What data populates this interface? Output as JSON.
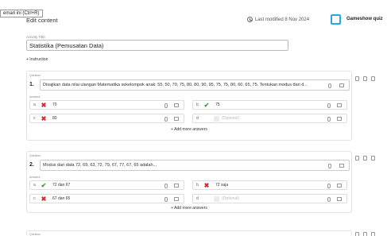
{
  "tooltip": "emari ini (Ctrl+R)",
  "header": {
    "title": "Edit content",
    "last_modified": "Last modified 8 Nov 2024",
    "mode_label": "Gameshow quiz"
  },
  "activity": {
    "label": "Activity Title",
    "title": "Statistika (Pemusatan Data)"
  },
  "instruction_label": "+ Instruction",
  "questions": [
    {
      "label": "Question",
      "number": "1.",
      "text": "Disajikan data nilai ulangan Matematika sekelompok anak: 55, 50, 70, 75, 80, 80, 90, 95, 75, 75, 80, 60, 65, 75. Tentukan modus dari d...",
      "answers_label": "Answers",
      "answers": [
        {
          "letter": "a",
          "mark": "✖",
          "text": "70"
        },
        {
          "letter": "b",
          "mark": "✔",
          "text": "75"
        },
        {
          "letter": "c",
          "mark": "✖",
          "text": "80"
        },
        {
          "letter": "d",
          "mark": "",
          "text": "(Optional)"
        }
      ],
      "add_more": "+ Add more answers"
    },
    {
      "label": "Question",
      "number": "2.",
      "text": "Modus dari data 72, 69, 63, 72, 79, 67, 77, 67, 65 adalah...",
      "answers_label": "Answers",
      "answers": [
        {
          "letter": "a",
          "mark": "✔",
          "text": "72 dan 67"
        },
        {
          "letter": "b",
          "mark": "✖",
          "text": "72 saja"
        },
        {
          "letter": "c",
          "mark": "✖",
          "text": "67 dan 65"
        },
        {
          "letter": "d",
          "mark": "",
          "text": "(Optional)"
        }
      ],
      "add_more": "+ Add more answers"
    },
    {
      "label": "Question"
    }
  ],
  "colors": {
    "accent": "#2aa6e8",
    "correct": "#2f9e44",
    "wrong": "#d42b2b"
  },
  "icons": [
    "history-icon",
    "mic-icon",
    "image-icon",
    "settings-icon",
    "delete-icon"
  ]
}
